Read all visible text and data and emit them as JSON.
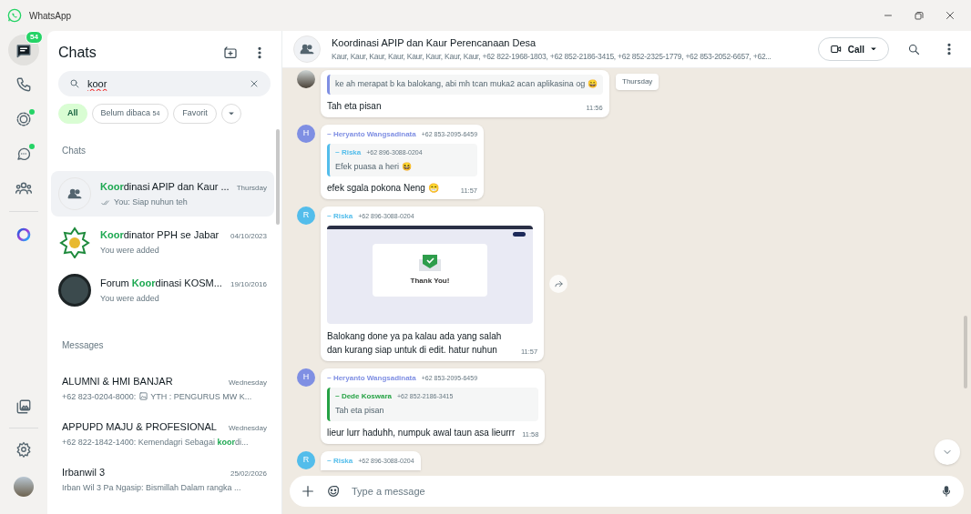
{
  "window": {
    "title": "WhatsApp"
  },
  "rail": {
    "top": [
      {
        "kind": "chats",
        "selected": true,
        "badge": "54"
      },
      {
        "kind": "calls",
        "selected": false
      },
      {
        "kind": "status",
        "selected": false,
        "dot": true
      },
      {
        "kind": "channels",
        "selected": false,
        "dot": true
      },
      {
        "kind": "communities",
        "selected": false
      },
      {
        "kind": "meta-ai",
        "selected": false
      }
    ],
    "bottom": [
      {
        "kind": "media"
      },
      {
        "kind": "settings"
      },
      {
        "kind": "profile"
      }
    ]
  },
  "chat_list": {
    "title": "Chats",
    "search": {
      "value": "koor"
    },
    "filters": [
      {
        "label": "All",
        "selected": true
      },
      {
        "label": "Belum dibaca",
        "count": "54",
        "selected": false
      },
      {
        "label": "Favorit",
        "selected": false
      }
    ],
    "sections": [
      {
        "heading": "Chats",
        "items": [
          {
            "avatar": {
              "kind": "group"
            },
            "name": [
              {
                "text": "Koor",
                "highlight": true
              },
              {
                "text": "dinasi APIP dan Kaur ...",
                "highlight": false
              }
            ],
            "time": "Thursday",
            "read": true,
            "selected": true,
            "preview": [
              {
                "kind": "text",
                "text": "You: Siap nuhun teh",
                "highlight": false
              }
            ]
          },
          {
            "avatar": {
              "kind": "logo"
            },
            "name": [
              {
                "text": "Koor",
                "highlight": true
              },
              {
                "text": "dinator PPH se Jabar",
                "highlight": false
              }
            ],
            "time": "04/10/2023",
            "selected": false,
            "preview": [
              {
                "kind": "text",
                "text": "You were added",
                "highlight": false
              }
            ]
          },
          {
            "avatar": {
              "kind": "photo"
            },
            "name": [
              {
                "text": "Forum ",
                "highlight": false
              },
              {
                "text": "Koor",
                "highlight": true
              },
              {
                "text": "dinasi KOSM...",
                "highlight": false
              }
            ],
            "time": "19/10/2016",
            "selected": false,
            "preview": [
              {
                "kind": "text",
                "text": "You were added",
                "highlight": false
              }
            ]
          }
        ]
      },
      {
        "heading": "Messages",
        "items": [
          {
            "name": [
              {
                "text": "ALUMNI & HMI BANJAR",
                "highlight": false
              }
            ],
            "time": "Wednesday",
            "selected": false,
            "preview": [
              {
                "kind": "text",
                "text": "+62 823-0204-8000: ",
                "highlight": false
              },
              {
                "kind": "photo"
              },
              {
                "kind": "text",
                "text": " YTH : PENGURUS MW K...",
                "highlight": false
              }
            ]
          },
          {
            "name": [
              {
                "text": "APPUPD MAJU & PROFESIONAL",
                "highlight": false
              }
            ],
            "time": "Wednesday",
            "selected": false,
            "preview": [
              {
                "kind": "text",
                "text": "+62 822-1842-1400: Kemendagri Sebagai ",
                "highlight": false
              },
              {
                "kind": "text",
                "text": "koor",
                "highlight": true
              },
              {
                "kind": "text",
                "text": "di...",
                "highlight": false
              }
            ]
          },
          {
            "name": [
              {
                "text": "Irbanwil 3",
                "highlight": false
              }
            ],
            "time": "25/02/2026",
            "selected": false,
            "preview": [
              {
                "kind": "text",
                "text": "Irban Wil 3 Pa Ngasip: Bismillah  Dalam rangka ...",
                "highlight": false
              }
            ]
          }
        ]
      }
    ]
  },
  "conversation": {
    "title": "Koordinasi APIP dan Kaur Perencanaan Desa",
    "members": "Kaur, Kaur, Kaur, Kaur, Kaur, Kaur, Kaur, Kaur, +62 822-1968-1803, +62 852-2186-3415, +62 852-2325-1779, +62 853-2052-6657, +62...",
    "call_button": "Call",
    "date_chip": "Thursday",
    "messages": [
      {
        "avatar": {
          "kind": "photo"
        },
        "quote": {
          "text": "ke ah merapat b ka balokang, abi mh tcan muka2 acan aplikasina og 😀",
          "color": "#7f8fe3"
        },
        "text": "Tah eta pisan",
        "time": "11:56"
      },
      {
        "avatar": {
          "kind": "initial",
          "letter": "H",
          "color": "#7f8fe3"
        },
        "sender": "~ Heryanto Wangsadinata",
        "phone": "+62 853-2095-6459",
        "quote": {
          "sender": "~ Riska",
          "phone": "+62 896-3088-0204",
          "text": "Efek puasa a heri 😆",
          "color": "#53bdeb"
        },
        "text": "efek sgala pokona Neng 😁",
        "time": "11:57"
      },
      {
        "avatar": {
          "kind": "initial",
          "letter": "R",
          "color": "#53bdeb"
        },
        "sender": "~ Riska",
        "phone": "+62 896-3088-0204",
        "image": {
          "heading": "Thank You!"
        },
        "text": "Balokang done ya pa kalau ada yang salah dan kurang siap untuk di edit. hatur nuhun",
        "time": "11:57",
        "forward_button": true
      },
      {
        "avatar": {
          "kind": "initial",
          "letter": "H",
          "color": "#7f8fe3"
        },
        "sender": "~ Heryanto Wangsadinata",
        "phone": "+62 853-2095-6459",
        "quote": {
          "sender": "~ Dede Koswara",
          "phone": "+62 852-2186-3415",
          "text": "Tah eta pisan",
          "color": "#25a244"
        },
        "text": "lieur lurr haduhh, numpuk awal taun asa lieurrr",
        "time": "11:58"
      },
      {
        "avatar": {
          "kind": "initial",
          "letter": "R",
          "color": "#53bdeb"
        },
        "sender": "~ Riska",
        "phone": "+62 896-3088-0204"
      }
    ],
    "composer": {
      "placeholder": "Type a message"
    }
  }
}
